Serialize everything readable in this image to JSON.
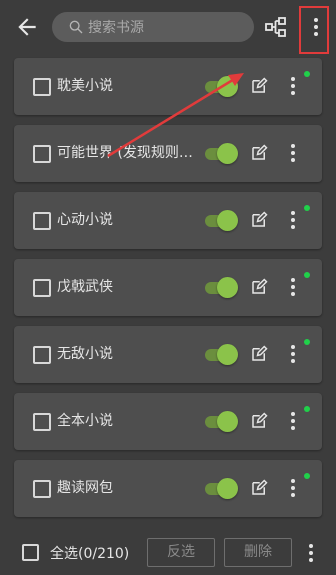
{
  "search": {
    "placeholder": "搜索书源"
  },
  "sources": [
    {
      "name": "耽美小说",
      "enabled": true,
      "badge": true
    },
    {
      "name": "可能世界 (发现规则为...",
      "enabled": true,
      "badge": false
    },
    {
      "name": "心动小说",
      "enabled": true,
      "badge": true
    },
    {
      "name": "戊戟武侠",
      "enabled": true,
      "badge": true
    },
    {
      "name": "无敌小说",
      "enabled": true,
      "badge": true
    },
    {
      "name": "全本小说",
      "enabled": true,
      "badge": true
    },
    {
      "name": "趣读网包",
      "enabled": true,
      "badge": true
    }
  ],
  "bottom": {
    "select_all": "全选(0/210)",
    "invert": "反选",
    "delete": "删除"
  },
  "colors": {
    "background": "#3c3c3c",
    "card": "#4e4e4e",
    "toggle_on": "#8bc34a",
    "badge": "#20d14a",
    "highlight": "#e13b3b"
  }
}
